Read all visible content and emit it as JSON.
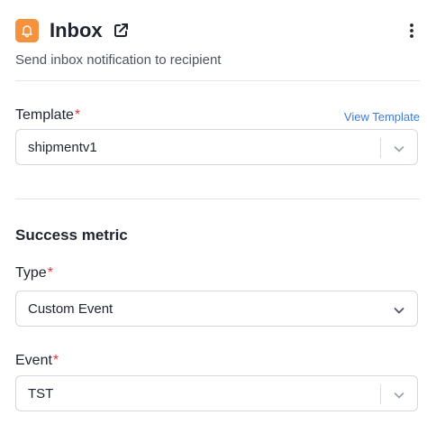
{
  "header": {
    "title": "Inbox",
    "subtitle": "Send inbox notification to recipient",
    "icon": "bell-icon",
    "external_link_icon": "external-link-icon",
    "menu_icon": "kebab-menu-icon",
    "accent_color": "#f6913d"
  },
  "template": {
    "label": "Template",
    "required_mark": "*",
    "view_link": "View Template",
    "value": "shipmentv1"
  },
  "success_metric": {
    "title": "Success metric",
    "type": {
      "label": "Type",
      "required_mark": "*",
      "value": "Custom Event"
    },
    "event": {
      "label": "Event",
      "required_mark": "*",
      "value": "TST"
    }
  }
}
